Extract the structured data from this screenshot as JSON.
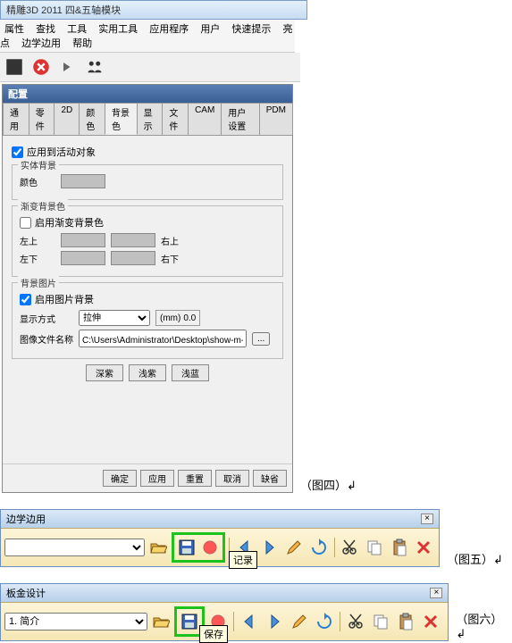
{
  "app": {
    "title": "精雕3D 2011 四&五轴模块"
  },
  "menu": {
    "items": [
      "属性",
      "查找",
      "工具",
      "实用工具",
      "应用程序",
      "用户",
      "快速提示",
      "亮点",
      "边学边用",
      "帮助"
    ]
  },
  "dialog": {
    "title": "配置",
    "tabs": [
      "通用",
      "零件",
      "2D",
      "颜色",
      "背景色",
      "显示",
      "文件",
      "CAM",
      "用户设置",
      "PDM"
    ],
    "active_tab": "背景色",
    "apply_active": "应用到活动对象",
    "solid_bg": {
      "title": "实体背景",
      "color_label": "颜色"
    },
    "grad_bg": {
      "title": "渐变背景色",
      "enable_label": "启用渐变背景色",
      "top_left": "左上",
      "top_right": "右上",
      "bottom_left": "左下",
      "bottom_right": "右下"
    },
    "img_bg": {
      "title": "背景图片",
      "enable_label": "启用图片背景",
      "mode_label": "显示方式",
      "mode_value": "拉伸",
      "unit_label": "(mm)",
      "unit_value": "0.0",
      "file_label": "图像文件名称",
      "file_value": "C:\\Users\\Administrator\\Desktop\\show-m-tell制作\\板金"
    },
    "preset_buttons": [
      "深紫",
      "浅紫",
      "浅蓝"
    ],
    "footer_buttons": [
      "确定",
      "应用",
      "重置",
      "取消",
      "缺省"
    ]
  },
  "captions": {
    "fig4": "（图四）↲",
    "fig5": "（图五）↲",
    "fig6": "（图六）↲"
  },
  "toolbar1": {
    "title": "边学边用",
    "combo_value": "",
    "tooltip": "记录"
  },
  "toolbar2": {
    "title": "板金设计",
    "combo_value": "1. 简介",
    "tooltip": "保存"
  }
}
